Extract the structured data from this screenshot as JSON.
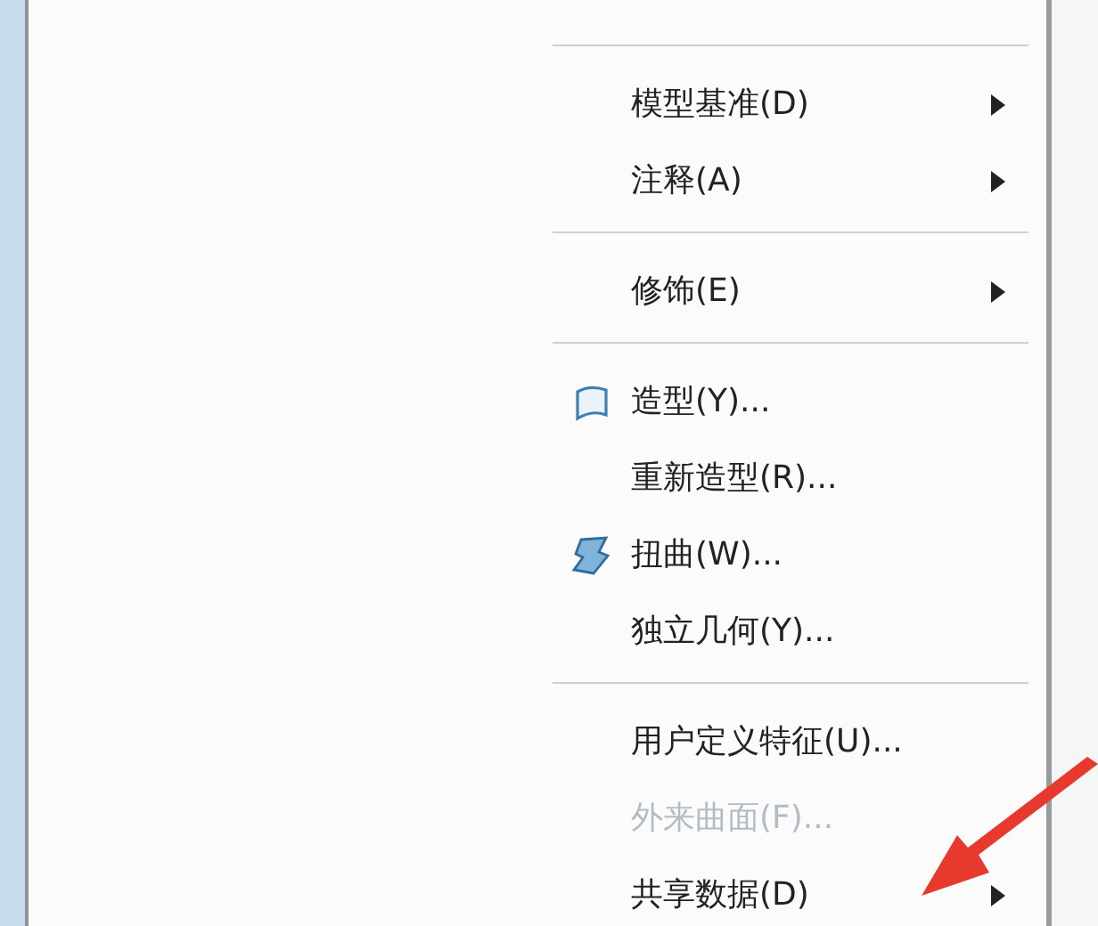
{
  "menu": {
    "groups": [
      {
        "items": [
          {
            "label": "模型基准(D)",
            "disabled": false,
            "submenu": true
          },
          {
            "label": "注释(A)",
            "disabled": false,
            "submenu": true
          }
        ]
      },
      {
        "items": [
          {
            "label": "修饰(E)",
            "disabled": false,
            "submenu": true
          }
        ]
      },
      {
        "items": [
          {
            "label": "造型(Y)...",
            "disabled": false,
            "submenu": false,
            "kind": "surface"
          },
          {
            "label": "重新造型(R)...",
            "disabled": false,
            "submenu": false
          },
          {
            "label": "扭曲(W)...",
            "disabled": false,
            "submenu": false,
            "kind": "warp"
          },
          {
            "label": "独立几何(Y)...",
            "disabled": false,
            "submenu": false
          }
        ]
      },
      {
        "items": [
          {
            "label": "用户定义特征(U)...",
            "disabled": false,
            "submenu": false
          },
          {
            "label": "外来曲面(F)...",
            "disabled": true,
            "submenu": false
          },
          {
            "label": "共享数据(D)",
            "disabled": false,
            "submenu": true
          }
        ]
      }
    ]
  }
}
